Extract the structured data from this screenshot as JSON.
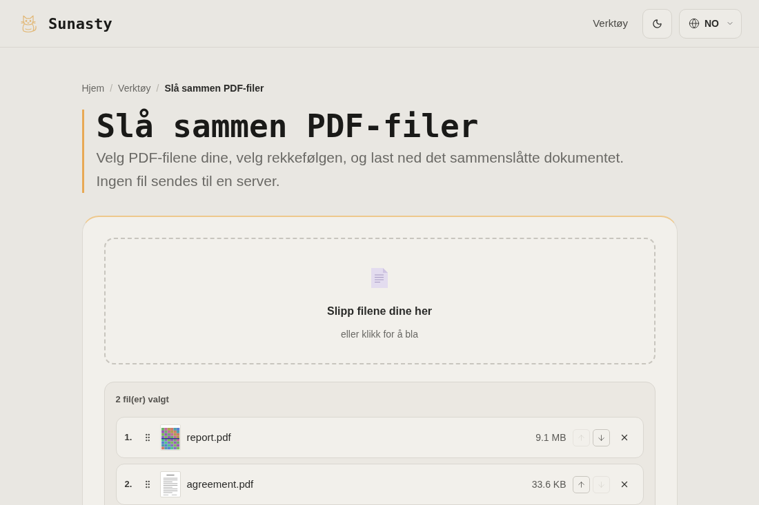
{
  "header": {
    "brand": "Sunasty",
    "nav_link": "Verktøy",
    "language": {
      "label": "NO"
    }
  },
  "breadcrumb": [
    {
      "kind": "link",
      "text": "Hjem"
    },
    {
      "kind": "separator",
      "text": "/"
    },
    {
      "kind": "link",
      "text": "Verktøy"
    },
    {
      "kind": "separator",
      "text": "/"
    },
    {
      "kind": "current",
      "text": "Slå sammen PDF-filer"
    }
  ],
  "page": {
    "title": "Slå sammen PDF-filer",
    "description": "Velg PDF-filene dine, velg rekkefølgen, og last ned det sammenslåtte dokumentet. Ingen fil sendes til en server."
  },
  "dropzone": {
    "title": "Slipp filene dine her",
    "hint": "eller klikk for å bla"
  },
  "file_list": {
    "count_label": "2 fil(er) valgt",
    "files": [
      {
        "number": "1.",
        "name": "report.pdf",
        "size": "9.1 MB",
        "kind": "image",
        "move_up_disabled": true,
        "move_down_disabled": false
      },
      {
        "number": "2.",
        "name": "agreement.pdf",
        "size": "33.6 KB",
        "kind": "document",
        "move_up_disabled": false,
        "move_down_disabled": true
      }
    ]
  }
}
